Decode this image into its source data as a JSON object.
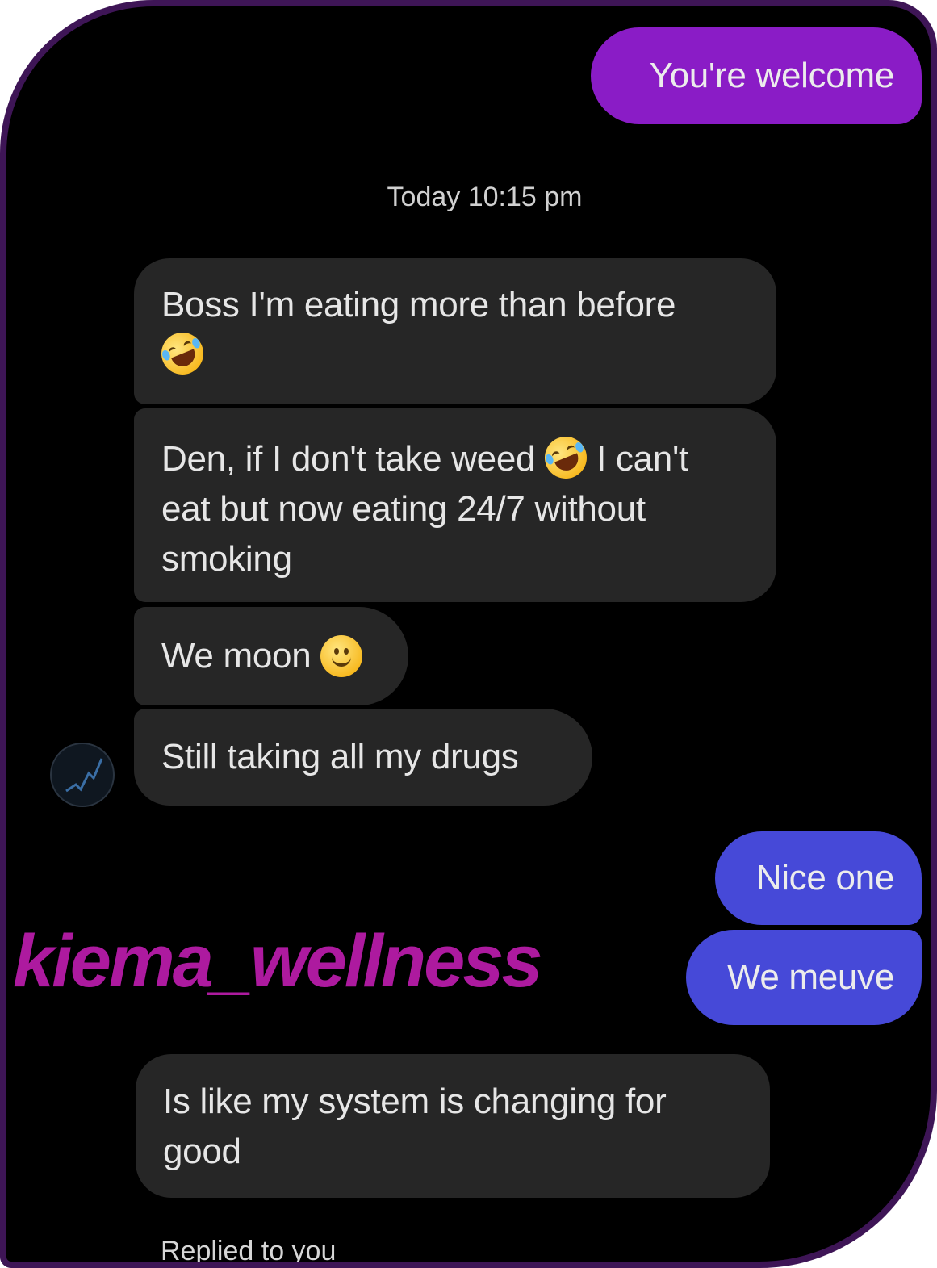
{
  "conversation": {
    "messages": [
      {
        "direction": "outgoing",
        "text": "You're welcome"
      },
      {
        "direction": "incoming",
        "text": "Boss I'm eating more than before",
        "emoji": "rolling-on-floor-laughing"
      },
      {
        "direction": "incoming",
        "text_before_emoji": "Den, if I don't take weed",
        "emoji": "rolling-on-floor-laughing",
        "text_after_emoji_line1": "I can't",
        "text_line2": "eat but now eating 24/7 without",
        "text_line3": "smoking"
      },
      {
        "direction": "incoming",
        "text": "We moon",
        "emoji": "slightly-smiling-face"
      },
      {
        "direction": "incoming",
        "text": "Still taking all my drugs"
      },
      {
        "direction": "outgoing",
        "text": "Nice one"
      },
      {
        "direction": "outgoing",
        "text": "We meuve"
      },
      {
        "direction": "incoming",
        "text_line1": "Is like my system is changing for",
        "text_line2": "good"
      }
    ],
    "timestamp": "Today 10:15 pm",
    "replied_label": "Replied to you"
  },
  "watermark": "kiema_wellness",
  "colors": {
    "background": "#000000",
    "frame_border": "#3e1556",
    "incoming_bubble": "#262626",
    "outgoing_purple": "#8a1cc6",
    "outgoing_blue": "#4649d8",
    "watermark": "#ad1a9f"
  },
  "icons": {
    "avatar": "contact-avatar",
    "laugh_emoji": "rolling-on-floor-laughing-emoji",
    "smile_emoji": "slightly-smiling-face-emoji"
  }
}
